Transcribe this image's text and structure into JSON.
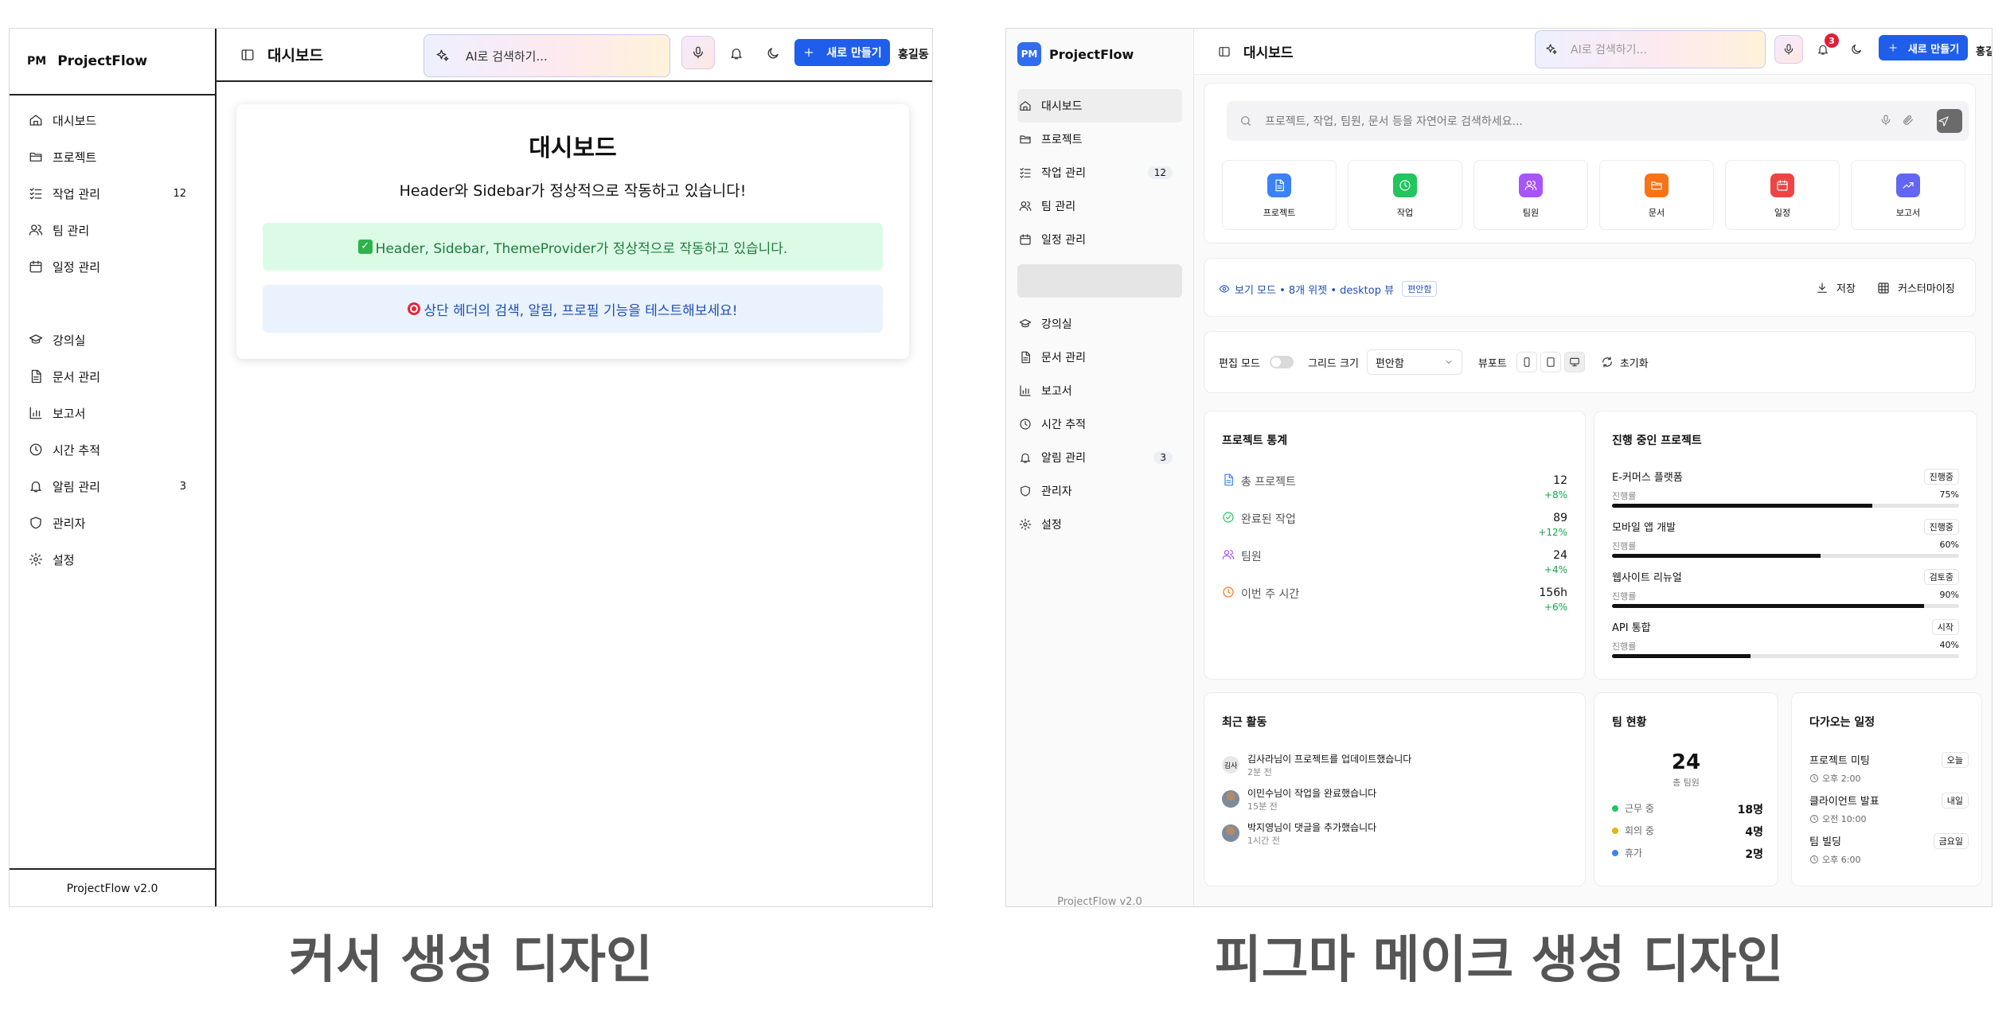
{
  "left": {
    "brand": {
      "abbr": "PM",
      "name": "ProjectFlow"
    },
    "nav": [
      {
        "label": "대시보드",
        "icon": "home-icon"
      },
      {
        "label": "프로젝트",
        "icon": "folder-icon"
      },
      {
        "label": "작업 관리",
        "icon": "task-list-icon",
        "count": "12"
      },
      {
        "label": "팀 관리",
        "icon": "users-icon"
      },
      {
        "label": "일정 관리",
        "icon": "calendar-icon"
      },
      {
        "label": "강의실",
        "icon": "graduation-cap-icon"
      },
      {
        "label": "문서 관리",
        "icon": "document-icon"
      },
      {
        "label": "보고서",
        "icon": "bar-chart-icon"
      },
      {
        "label": "시간 추적",
        "icon": "clock-icon"
      },
      {
        "label": "알림 관리",
        "icon": "bell-icon",
        "count": "3"
      },
      {
        "label": "관리자",
        "icon": "shield-icon"
      },
      {
        "label": "설정",
        "icon": "gear-icon"
      }
    ],
    "footer": "ProjectFlow v2.0",
    "header": {
      "title": "대시보드",
      "ai_placeholder": "AI로 검색하기...",
      "new_label": "새로 만들기",
      "user": "홍길동"
    },
    "card": {
      "title": "대시보드",
      "subtitle": "Header와 Sidebar가 정상적으로 작동하고 있습니다!",
      "success": "Header, Sidebar, ThemeProvider가 정상적으로 작동하고 있습니다.",
      "info": "상단 헤더의 검색, 알림, 프로필 기능을 테스트해보세요!"
    },
    "caption": "커서 생성 디자인"
  },
  "right": {
    "brand": {
      "abbr": "PM",
      "name": "ProjectFlow"
    },
    "nav": [
      {
        "label": "대시보드",
        "icon": "home-icon"
      },
      {
        "label": "프로젝트",
        "icon": "folder-icon"
      },
      {
        "label": "작업 관리",
        "icon": "task-list-icon",
        "count": "12"
      },
      {
        "label": "팀 관리",
        "icon": "users-icon"
      },
      {
        "label": "일정 관리",
        "icon": "calendar-icon"
      },
      {
        "label": "강의실",
        "icon": "graduation-cap-icon"
      },
      {
        "label": "문서 관리",
        "icon": "document-icon"
      },
      {
        "label": "보고서",
        "icon": "bar-chart-icon"
      },
      {
        "label": "시간 추적",
        "icon": "clock-icon"
      },
      {
        "label": "알림 관리",
        "icon": "bell-icon",
        "count": "3"
      },
      {
        "label": "관리자",
        "icon": "shield-icon"
      },
      {
        "label": "설정",
        "icon": "gear-icon"
      }
    ],
    "footer": "ProjectFlow v2.0",
    "header": {
      "title": "대시보드",
      "ai_placeholder": "AI로 검색하기...",
      "notif_count": "3",
      "new_label": "새로 만들기",
      "user": "홍길동"
    },
    "search_placeholder": "프로젝트, 작업, 팀원, 문서 등을 자연어로 검색하세요...",
    "quick": [
      {
        "label": "프로젝트",
        "color": "#3b82f6",
        "icon": "document-icon"
      },
      {
        "label": "작업",
        "color": "#22c55e",
        "icon": "clock-icon"
      },
      {
        "label": "팀원",
        "color": "#a855f7",
        "icon": "users-icon"
      },
      {
        "label": "문서",
        "color": "#f97316",
        "icon": "folder-icon"
      },
      {
        "label": "일정",
        "color": "#ef4444",
        "icon": "calendar-icon"
      },
      {
        "label": "보고서",
        "color": "#6366f1",
        "icon": "trend-icon"
      }
    ],
    "viewbar": {
      "mode": "보기 모드 • 8개 위젯 • desktop 뷰",
      "badge": "편안함",
      "save": "저장",
      "customize": "커스터마이징"
    },
    "editbar": {
      "edit_label": "편집 모드",
      "grid_label": "그리드 크기",
      "grid_value": "편안함",
      "viewport_label": "뷰포트",
      "reset": "초기화"
    },
    "stats": {
      "title": "프로젝트 통계",
      "rows": [
        {
          "label": "총 프로젝트",
          "value": "12",
          "delta": "+8%",
          "icon": "document-icon",
          "color": "#3b82f6"
        },
        {
          "label": "완료된 작업",
          "value": "89",
          "delta": "+12%",
          "icon": "check-circle-icon",
          "color": "#22c55e"
        },
        {
          "label": "팀원",
          "value": "24",
          "delta": "+4%",
          "icon": "users-icon",
          "color": "#a855f7"
        },
        {
          "label": "이번 주 시간",
          "value": "156h",
          "delta": "+6%",
          "icon": "clock-icon",
          "color": "#f97316"
        }
      ]
    },
    "progress": {
      "title": "진행 중인 프로젝트",
      "progress_label": "진행률",
      "rows": [
        {
          "name": "E-커머스 플랫폼",
          "status": "진행중",
          "pct": "75%",
          "value": 75
        },
        {
          "name": "모바일 앱 개발",
          "status": "진행중",
          "pct": "60%",
          "value": 60
        },
        {
          "name": "웹사이트 리뉴얼",
          "status": "검토중",
          "pct": "90%",
          "value": 90
        },
        {
          "name": "API 통합",
          "status": "시작",
          "pct": "40%",
          "value": 40
        }
      ]
    },
    "activity": {
      "title": "최근 활동",
      "rows": [
        {
          "avatar": "김사",
          "text": "김사라님이 프로젝트를 업데이트했습니다",
          "time": "2분 전"
        },
        {
          "avatar": "",
          "text": "이민수님이 작업을 완료했습니다",
          "time": "15분 전"
        },
        {
          "avatar": "",
          "text": "박지영님이 댓글을 추가했습니다",
          "time": "1시간 전"
        }
      ]
    },
    "team": {
      "title": "팀 현황",
      "total": "24",
      "total_label": "총 팀원",
      "rows": [
        {
          "label": "근무 중",
          "value": "18명",
          "color": "#22c55e"
        },
        {
          "label": "회의 중",
          "value": "4명",
          "color": "#eab308"
        },
        {
          "label": "휴가",
          "value": "2명",
          "color": "#3b82f6"
        }
      ]
    },
    "schedule": {
      "title": "다가오는 일정",
      "rows": [
        {
          "name": "프로젝트 미팅",
          "day": "오늘",
          "time": "오후 2:00"
        },
        {
          "name": "클라이언트 발표",
          "day": "내일",
          "time": "오전 10:00"
        },
        {
          "name": "팀 빌딩",
          "day": "금요일",
          "time": "오후 6:00"
        }
      ]
    },
    "caption": "피그마 메이크 생성 디자인"
  }
}
